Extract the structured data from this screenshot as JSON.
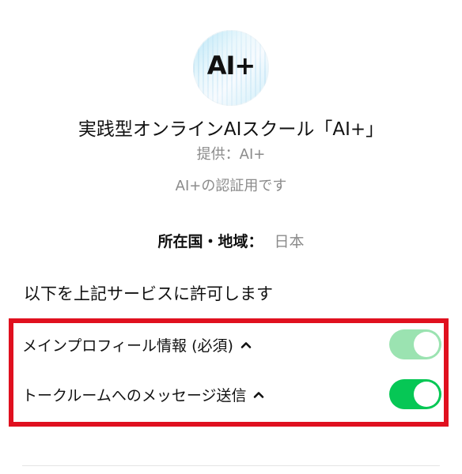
{
  "app": {
    "logo_text": "AI+",
    "title": "実践型オンラインAIスクール「AI+」",
    "provider": "提供：AI+",
    "purpose": "AI+の認証用です"
  },
  "region": {
    "label": "所在国・地域：",
    "value": "日本"
  },
  "permissions": {
    "intro": "以下を上記サービスに許可します",
    "items": [
      {
        "label": "メインプロフィール情報 (必須)",
        "state": "on-required",
        "icon": "chevron-up-icon"
      },
      {
        "label": "トークルームへのメッセージ送信",
        "state": "on",
        "icon": "chevron-up-icon"
      }
    ]
  },
  "colors": {
    "highlight_border": "#e0101f",
    "toggle_on": "#06c755",
    "toggle_required": "#9be3b1",
    "secondary_text": "#8b8b8b"
  }
}
